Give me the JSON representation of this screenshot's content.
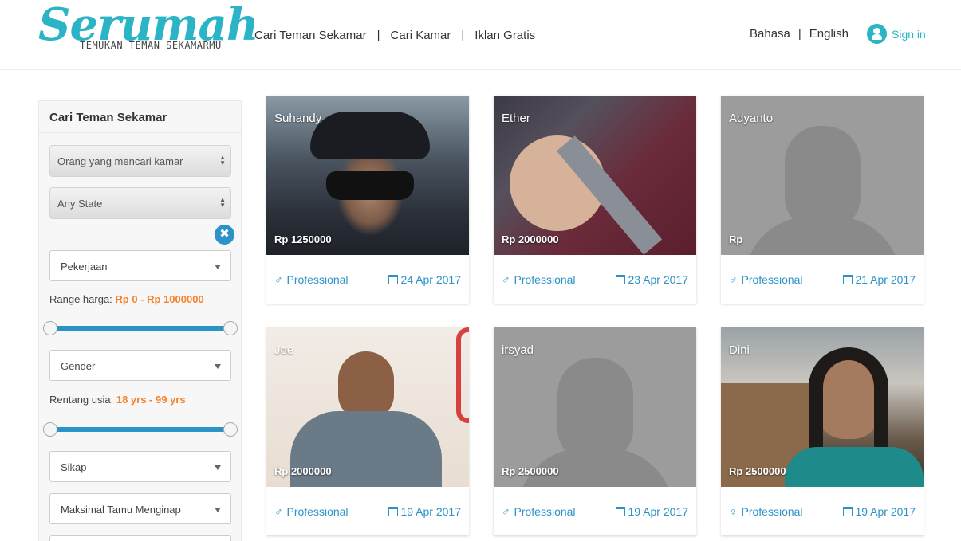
{
  "header": {
    "logo": "Serumah",
    "tagline": "TEMUKAN TEMAN SEKAMARMU",
    "nav": [
      "Cari Teman Sekamar",
      "Cari Kamar",
      "Iklan Gratis"
    ],
    "lang_a": "Bahasa",
    "lang_b": "English",
    "signin": "Sign in"
  },
  "sidebar": {
    "title": "Cari Teman Sekamar",
    "type_select": "Orang yang mencari kamar",
    "state_select": "Any State",
    "clear": "✖",
    "job": "Pekerjaan",
    "price_label": "Range harga:",
    "price_value": "Rp 0 - Rp 1000000",
    "gender": "Gender",
    "age_label": "Rentang usia:",
    "age_value": "18 yrs - 99 yrs",
    "attitude": "Sikap",
    "guests": "Maksimal Tamu Menginap"
  },
  "colors": {
    "brand": "#2bb3c6",
    "link": "#2b93c6",
    "accent": "#f5822a"
  },
  "cards": [
    {
      "name": "Suhandy",
      "price": "Rp 1250000",
      "gender_icon": "♂",
      "occupation": "Professional",
      "date": "24 Apr 2017"
    },
    {
      "name": "Ether",
      "price": "Rp 2000000",
      "gender_icon": "♂",
      "occupation": "Professional",
      "date": "23 Apr 2017"
    },
    {
      "name": "Adyanto",
      "price": "Rp",
      "gender_icon": "♂",
      "occupation": "Professional",
      "date": "21 Apr 2017"
    },
    {
      "name": "Joe",
      "price": "Rp 2000000",
      "gender_icon": "♂",
      "occupation": "Professional",
      "date": "19 Apr 2017"
    },
    {
      "name": "irsyad",
      "price": "Rp 2500000",
      "gender_icon": "♂",
      "occupation": "Professional",
      "date": "19 Apr 2017"
    },
    {
      "name": "Dini",
      "price": "Rp 2500000",
      "gender_icon": "♀",
      "occupation": "Professional",
      "date": "19 Apr 2017"
    }
  ]
}
